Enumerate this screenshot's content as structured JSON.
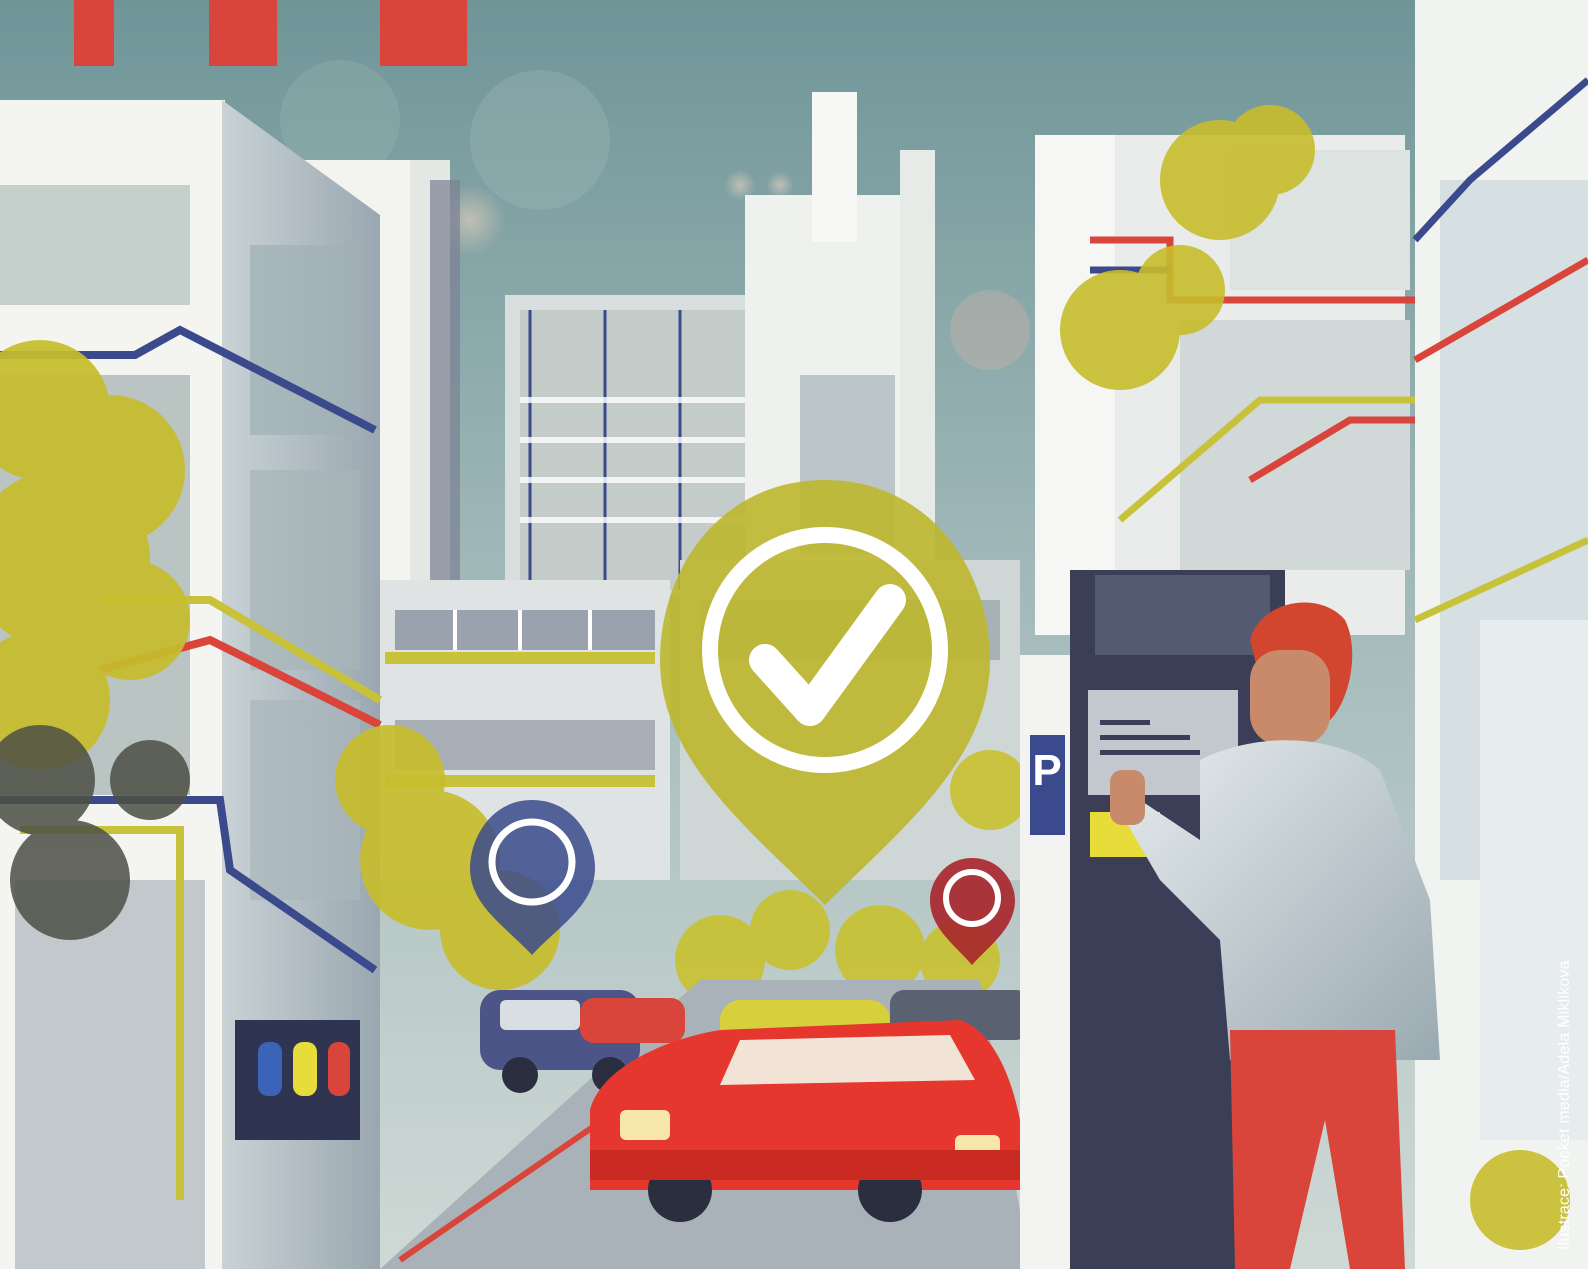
{
  "illustration": {
    "kind": "editorial-illustration",
    "subject": "smart city street with parking meter, map pins, cars",
    "icons": [
      "check-mark-pin-icon",
      "map-pin-icon",
      "parking-sign-icon",
      "car-icon"
    ],
    "palette": {
      "sky": "#7fa3a6",
      "building": "#e8eceb",
      "accent_red": "#d9453a",
      "accent_yellow": "#c8c23a",
      "navy": "#3a3f57",
      "circuit_blue": "#3b4a8c"
    },
    "parking_sign_letter": "P"
  },
  "credit": "Ilustrace: Pocket media/Adela Miklikova"
}
